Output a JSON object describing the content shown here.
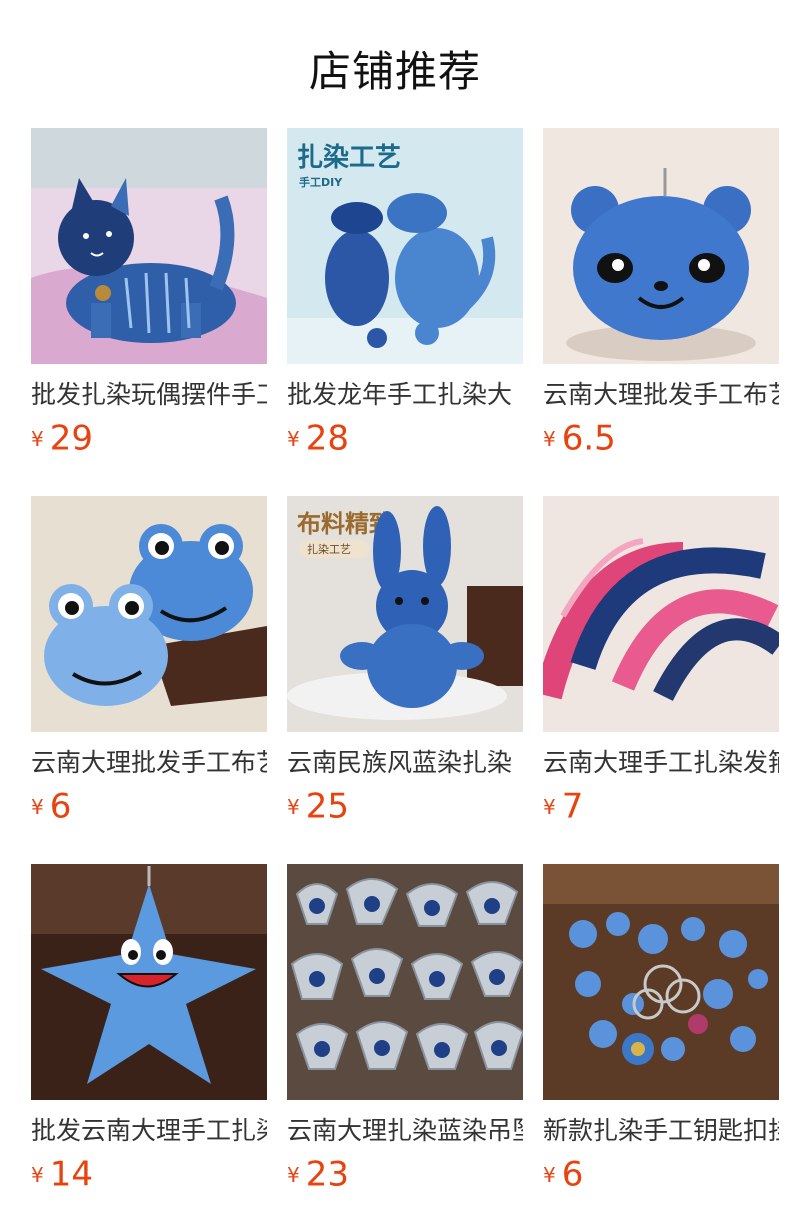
{
  "section": {
    "title": "店铺推荐"
  },
  "currency": "¥",
  "products": [
    {
      "name": "批发扎染玩偶摆件手工",
      "price": "29",
      "image": "tie-dye-cat-toy"
    },
    {
      "name": "批发龙年手工扎染大",
      "price": "28",
      "image": "tie-dye-dragon-toys",
      "image_text": {
        "title": "扎染工艺",
        "sub": "手工DIY"
      }
    },
    {
      "name": "云南大理批发手工布艺",
      "price": "6.5",
      "image": "tie-dye-panda-keychain"
    },
    {
      "name": "云南大理批发手工布艺",
      "price": "6",
      "image": "tie-dye-frog-toys"
    },
    {
      "name": "云南民族风蓝染扎染",
      "price": "25",
      "image": "tie-dye-rabbit-toy",
      "image_text": {
        "title": "布料精致",
        "sub": "扎染工艺"
      }
    },
    {
      "name": "云南大理手工扎染发箍",
      "price": "7",
      "image": "tie-dye-headbands"
    },
    {
      "name": "批发云南大理手工扎染",
      "price": "14",
      "image": "tie-dye-starfish-toy"
    },
    {
      "name": "云南大理扎染蓝染吊坠",
      "price": "23",
      "image": "blue-white-porcelain-pendants"
    },
    {
      "name": "新款扎染手工钥匙扣挂件",
      "price": "6",
      "image": "tie-dye-keychains-assortment"
    }
  ]
}
